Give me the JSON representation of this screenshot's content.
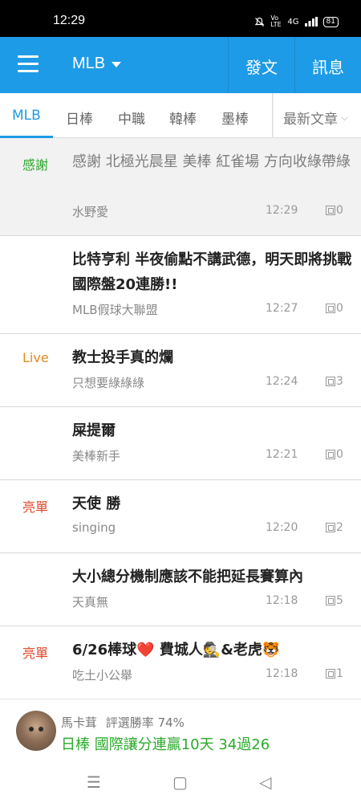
{
  "status_bar": {
    "time": "12:29",
    "icons": [
      "mute-icon",
      "volte-icon",
      "signal-icon"
    ],
    "vo_lte": "Vo LTE",
    "net": "4G",
    "battery": "81"
  },
  "app_bar": {
    "board": "MLB",
    "post_label": "發文",
    "messages_label": "訊息"
  },
  "tabs": [
    {
      "label": "MLB",
      "active": true
    },
    {
      "label": "日棒"
    },
    {
      "label": "中職"
    },
    {
      "label": "韓棒"
    },
    {
      "label": "墨棒"
    }
  ],
  "sort": {
    "label": "最新文章"
  },
  "posts": [
    {
      "tag": "感謝",
      "tag_color": "#2aa52a",
      "title": "感謝 北極光晨星 美棒 紅雀場 方向收綠帶綠",
      "author": "水野愛",
      "time": "12:29",
      "replies": "0",
      "read": true
    },
    {
      "tag": "",
      "title": "比特亨利 半夜偷點不講武德，明天即將挑戰國際盤20連勝!!",
      "author": "MLB假球大聯盟",
      "time": "12:27",
      "replies": "0"
    },
    {
      "tag": "Live",
      "tag_color": "#e8891b",
      "title": "教士投手真的爛",
      "author": "只想要綠綠綠",
      "time": "12:24",
      "replies": "3"
    },
    {
      "tag": "",
      "title": "屎提爾",
      "author": "美棒新手",
      "time": "12:21",
      "replies": "0"
    },
    {
      "tag": "亮單",
      "tag_color": "#e2472c",
      "title": "天使 勝",
      "author": "singing",
      "time": "12:20",
      "replies": "2"
    },
    {
      "tag": "",
      "title": "大小總分機制應該不能把延長賽算內",
      "author": "天真無",
      "time": "12:18",
      "replies": "5"
    },
    {
      "tag": "亮單",
      "tag_color": "#e2472c",
      "title": "6/26棒球❤️ 費城人🕵️&老虎🐯",
      "author": "吃土小公舉",
      "time": "12:18",
      "replies": "1"
    }
  ],
  "pick_banner": {
    "user": "馬卡茸",
    "rate": "評選勝率 74%",
    "text": "日棒 國際讓分連贏10天 34過26"
  },
  "nav": {
    "menu": "☰",
    "home": "▢",
    "back": "◁"
  }
}
